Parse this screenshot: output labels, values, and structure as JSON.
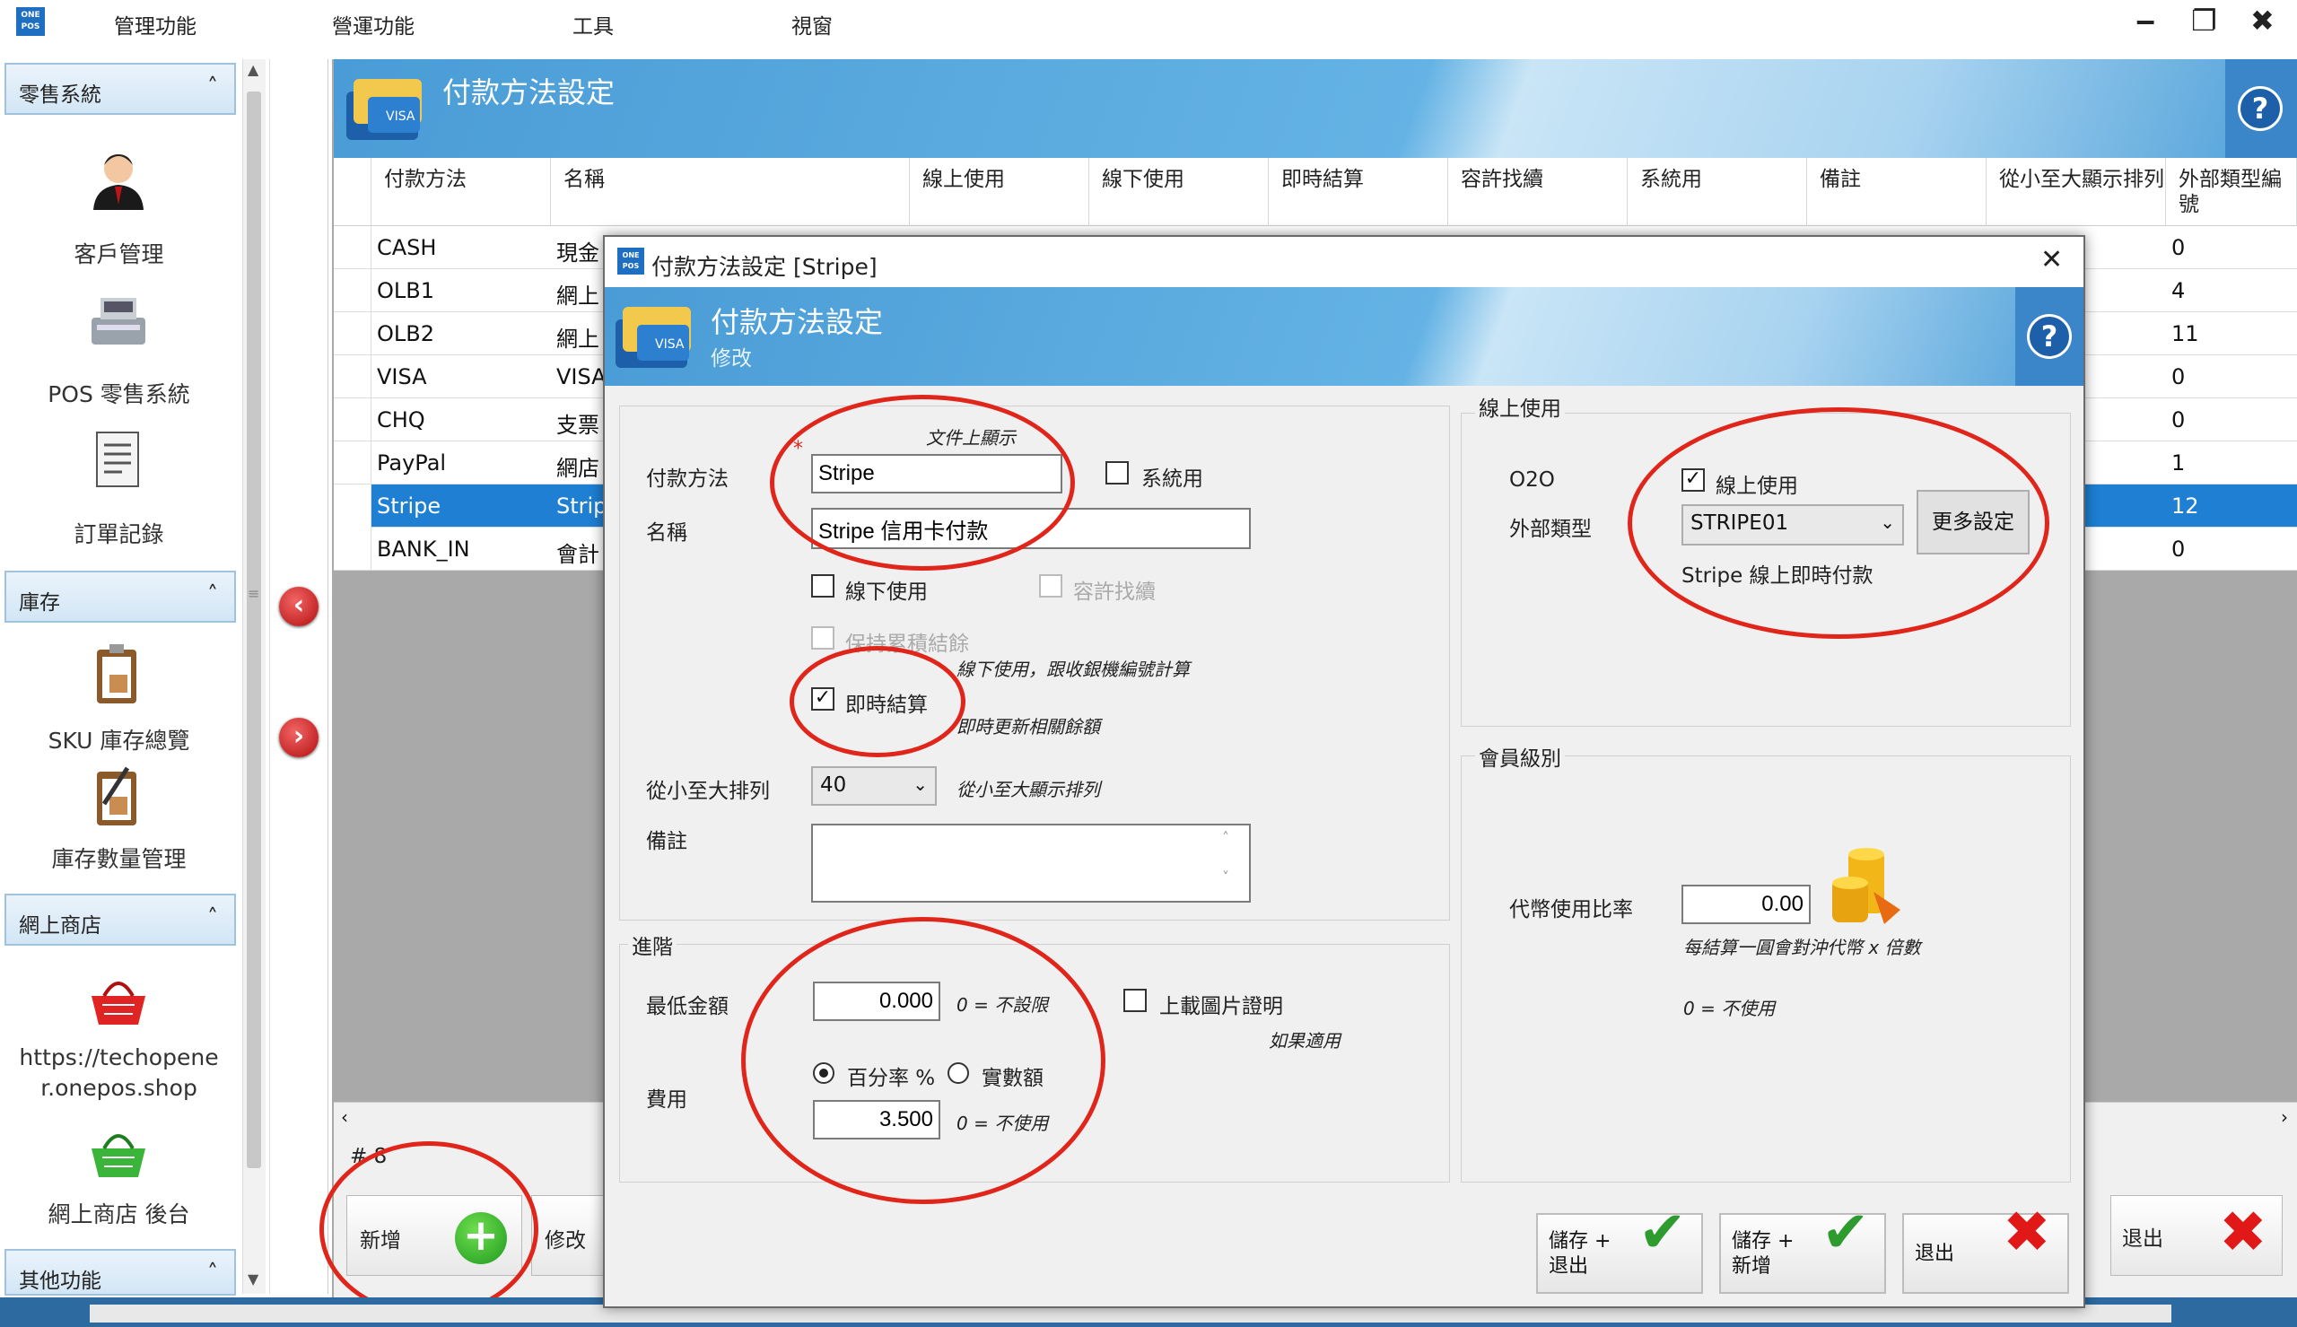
{
  "app": {
    "logo_text": "ONE POS",
    "menu": [
      "管理功能",
      "營運功能",
      "工具",
      "視窗"
    ],
    "window_controls": {
      "minimize": "‒",
      "restore": "❐",
      "close": "✖"
    }
  },
  "sidebar": {
    "sections": [
      {
        "title": "零售系統",
        "chevron": "˄",
        "items": [
          "客戶管理",
          "POS 零售系統",
          "訂單記錄"
        ]
      },
      {
        "title": "庫存",
        "chevron": "˄",
        "items": [
          "SKU 庫存總覽",
          "庫存數量管理"
        ]
      },
      {
        "title": "網上商店",
        "chevron": "˄",
        "items": [
          "https://techopener.onepos.shop",
          "網上商店 後台"
        ]
      },
      {
        "title": "其他功能",
        "chevron": "˄",
        "items": []
      }
    ]
  },
  "main": {
    "title": "付款方法設定",
    "help": "?",
    "columns": [
      "付款方法",
      "名稱",
      "線上使用",
      "線下使用",
      "即時結算",
      "容許找續",
      "系統用",
      "備註",
      "從小至大顯示排列",
      "外部類型編號"
    ],
    "rows": [
      {
        "code": "CASH",
        "name": "現金",
        "ext": "0",
        "selected": false
      },
      {
        "code": "OLB1",
        "name": "網上",
        "ext": "4",
        "selected": false
      },
      {
        "code": "OLB2",
        "name": "網上",
        "ext": "11",
        "selected": false
      },
      {
        "code": "VISA",
        "name": "VISA",
        "ext": "0",
        "selected": false
      },
      {
        "code": "CHQ",
        "name": "支票",
        "ext": "0",
        "selected": false
      },
      {
        "code": "PayPal",
        "name": "網店",
        "ext": "1",
        "selected": false
      },
      {
        "code": "Stripe",
        "name": "Strip",
        "ext": "12",
        "selected": true
      },
      {
        "code": "BANK_IN",
        "name": "會計",
        "ext": "0",
        "selected": false
      }
    ],
    "record_count": "# 8",
    "buttons": {
      "add": "新增",
      "edit": "修改",
      "exit": "退出"
    }
  },
  "dialog": {
    "window_title": "付款方法設定 [Stripe]",
    "header_title": "付款方法設定",
    "header_subtitle": "修改",
    "help": "?",
    "close": "✕",
    "general": {
      "doc_display_note": "文件上顯示",
      "method_label": "付款方法",
      "method_value": "Stripe",
      "system_label": "系統用",
      "system_checked": false,
      "name_label": "名稱",
      "name_value": "Stripe 信用卡付款",
      "offline_label": "線下使用",
      "offline_checked": false,
      "change_label": "容許找續",
      "keep_balance_label": "保持累積結餘",
      "offline_note": "線下使用，跟收銀機編號計算",
      "instant_label": "即時結算",
      "instant_checked": true,
      "instant_note": "即時更新相關餘額",
      "sort_label": "從小至大排列",
      "sort_value": "40",
      "sort_note": "從小至大顯示排列",
      "remark_label": "備註",
      "remark_value": ""
    },
    "advanced": {
      "title": "進階",
      "min_amount_label": "最低金額",
      "min_amount_value": "0.000",
      "min_amount_note": "0 = 不設限",
      "upload_label": "上載圖片證明",
      "upload_checked": false,
      "upload_note": "如果適用",
      "fee_label": "費用",
      "percent_label": "百分率 %",
      "fixed_label": "實數額",
      "fee_mode": "percent",
      "fee_value": "3.500",
      "fee_note": "0 = 不使用"
    },
    "online": {
      "title": "線上使用",
      "o2o_label": "O2O",
      "online_use_label": "線上使用",
      "online_use_checked": true,
      "ext_type_label": "外部類型",
      "ext_type_value": "STRIPE01",
      "more_settings": "更多設定",
      "description": "Stripe 線上即時付款"
    },
    "member": {
      "title": "會員級別",
      "token_rate_label": "代幣使用比率",
      "token_rate_value": "0.00",
      "token_note": "每結算一圓會對沖代幣 x 倍數",
      "zero_note": "0 = 不使用"
    },
    "buttons": {
      "save_exit": "儲存 + 退出",
      "save_new": "儲存 + 新增",
      "exit": "退出"
    }
  },
  "colors": {
    "accent": "#1e7fd3",
    "annotation": "#e0261b",
    "confirm": "#2e9b2e",
    "cancel": "#e01818"
  },
  "icons": [
    "customer-icon",
    "pos-register-icon",
    "order-record-icon",
    "sku-clipboard-icon",
    "inventory-edit-icon",
    "shop-basket-icon",
    "shop-admin-basket-icon",
    "payment-cards-icon",
    "coins-icon",
    "add-icon",
    "check-icon",
    "cross-icon"
  ]
}
